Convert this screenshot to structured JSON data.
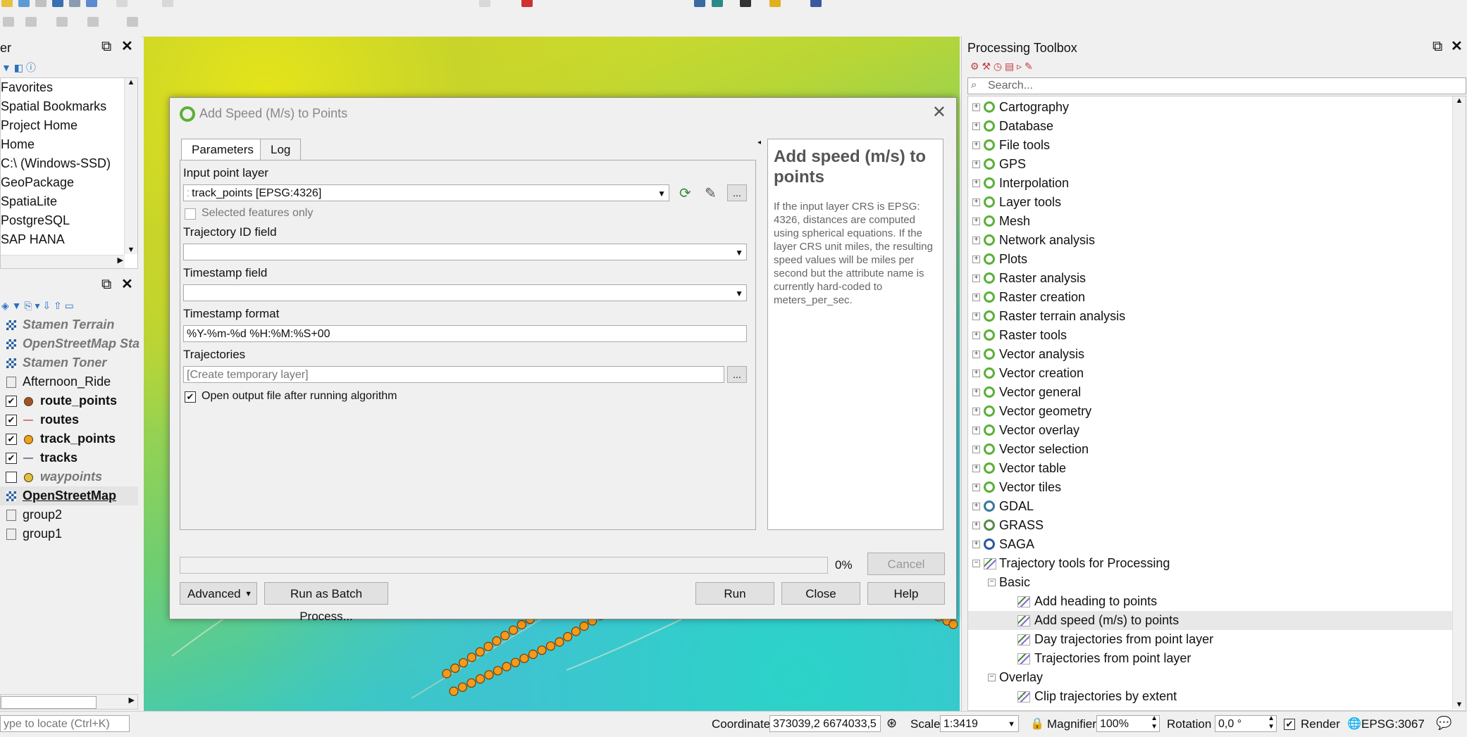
{
  "browser_panel": {
    "title": "er",
    "items": [
      "Favorites",
      "Spatial Bookmarks",
      "Project Home",
      "Home",
      "C:\\ (Windows-SSD)",
      "GeoPackage",
      "SpatiaLite",
      "PostgreSQL",
      "SAP HANA"
    ]
  },
  "layers_panel": {
    "layers": [
      {
        "name": "Stamen Terrain",
        "style": "italic-bold-gray",
        "icon": "raster-icon"
      },
      {
        "name": "OpenStreetMap Sta",
        "style": "italic-bold-gray",
        "icon": "raster-icon"
      },
      {
        "name": "Stamen Toner",
        "style": "italic-bold-gray",
        "icon": "raster-icon"
      },
      {
        "name": "Afternoon_Ride",
        "style": "normal",
        "icon": "group-icon"
      },
      {
        "name": "route_points",
        "style": "bold",
        "icon": "point-icon",
        "checked": true,
        "color": "#a0522d"
      },
      {
        "name": "routes",
        "style": "bold",
        "icon": "line-icon",
        "checked": true,
        "color": "#d08080"
      },
      {
        "name": "track_points",
        "style": "bold",
        "icon": "point-icon",
        "checked": true,
        "color": "#f0a020"
      },
      {
        "name": "tracks",
        "style": "bold",
        "icon": "line-icon",
        "checked": true,
        "color": "#8080a0"
      },
      {
        "name": "waypoints",
        "style": "italic-bold-gray",
        "icon": "point-icon",
        "checked": false,
        "color": "#e0c040"
      },
      {
        "name": "OpenStreetMap",
        "style": "bold-underline",
        "icon": "raster-icon"
      },
      {
        "name": "group2",
        "style": "normal",
        "icon": "group-icon"
      },
      {
        "name": "group1",
        "style": "normal",
        "icon": "group-icon"
      }
    ]
  },
  "dialog": {
    "title": "Add Speed (M/s) to Points",
    "tabs": [
      "Parameters",
      "Log"
    ],
    "input_layer_label": "Input point layer",
    "input_layer_value": "track_points [EPSG:4326]",
    "selected_only_label": "Selected features only",
    "trajectory_id_label": "Trajectory ID field",
    "timestamp_field_label": "Timestamp field",
    "timestamp_format_label": "Timestamp format",
    "timestamp_format_value": "%Y-%m-%d %H:%M:%S+00",
    "trajectories_label": "Trajectories",
    "trajectories_placeholder": "[Create temporary layer]",
    "open_output_label": "Open output file after running algorithm",
    "help_title": "Add speed (m/s) to points",
    "help_text": "If the input layer CRS is EPSG: 4326, distances are computed using spherical equations. If the layer CRS unit miles, the resulting speed values will be miles per second but the attribute name is currently hard-coded to meters_per_sec.",
    "progress": "0%",
    "progress_value": 0,
    "cancel_label": "Cancel",
    "advanced_label": "Advanced",
    "batch_label": "Run as Batch Process...",
    "run_label": "Run",
    "close_label": "Close",
    "help_label": "Help",
    "ellipsis": "..."
  },
  "toolbox": {
    "title": "Processing Toolbox",
    "search_placeholder": "Search...",
    "providers": [
      "Cartography",
      "Database",
      "File tools",
      "GPS",
      "Interpolation",
      "Layer tools",
      "Mesh",
      "Network analysis",
      "Plots",
      "Raster analysis",
      "Raster creation",
      "Raster terrain analysis",
      "Raster tools",
      "Vector analysis",
      "Vector creation",
      "Vector general",
      "Vector geometry",
      "Vector overlay",
      "Vector selection",
      "Vector table",
      "Vector tiles"
    ],
    "external": [
      "GDAL",
      "GRASS",
      "SAGA"
    ],
    "plugin": "Trajectory tools for Processing",
    "groups": [
      {
        "name": "Basic",
        "algorithms": [
          "Add heading to points",
          "Add speed (m/s) to points",
          "Day trajectories from point layer",
          "Trajectories from point layer"
        ]
      },
      {
        "name": "Overlay",
        "algorithms": [
          "Clip trajectories by extent"
        ]
      }
    ]
  },
  "statusbar": {
    "locate_placeholder": "ype to locate (Ctrl+K)",
    "coordinate_label": "Coordinate",
    "coordinate_value": "373039,2 6674033,5",
    "scale_label": "Scale",
    "scale_value": "1:3419",
    "magnifier_label": "Magnifier",
    "magnifier_value": "100%",
    "rotation_label": "Rotation",
    "rotation_value": "0,0 °",
    "render_label": "Render",
    "crs_label": "EPSG:3067"
  }
}
